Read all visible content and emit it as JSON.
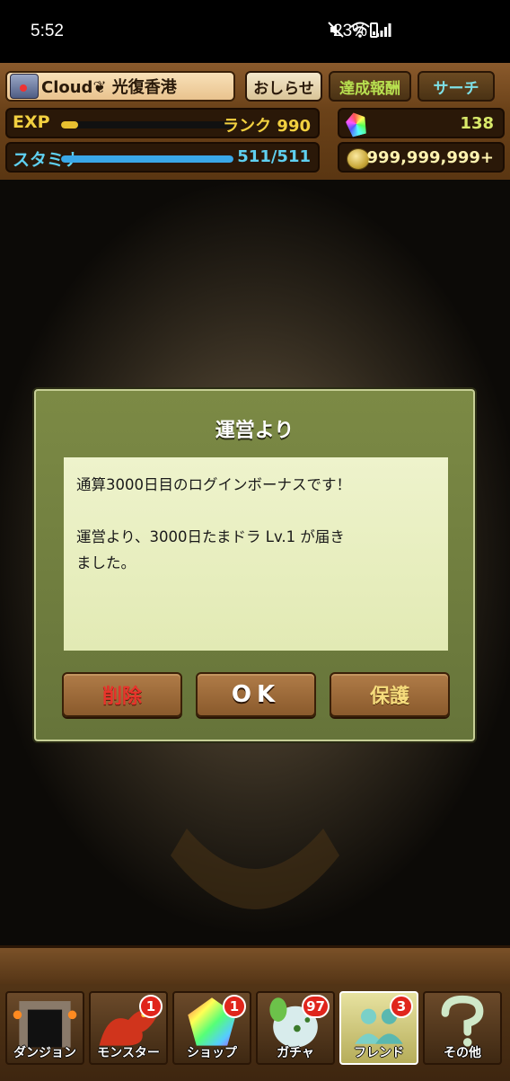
{
  "status_bar": {
    "time": "5:52",
    "battery": "23%"
  },
  "header": {
    "player_name": "Cloud❦ 光復香港",
    "news_label": "おしらせ",
    "achievements_label": "達成報酬",
    "search_label": "サーチ",
    "exp": {
      "label": "EXP",
      "rank_text": "ランク 990",
      "progress": 0.1
    },
    "stamina": {
      "label": "スタミナ",
      "value_text": "511/511",
      "progress": 1.0
    },
    "magic_stones": "138",
    "coins": "999,999,999+"
  },
  "dialog": {
    "title": "運営より",
    "message_lines": [
      "通算3000日目のログインボーナスです！",
      "",
      "運営より、3000日たまドラ  Lv.1 が届き",
      "ました。"
    ],
    "delete_label": "削除",
    "ok_label": "OK",
    "protect_label": "保護"
  },
  "nav": {
    "dungeon": {
      "label": "ダンジョン"
    },
    "monster": {
      "label": "モンスター",
      "badge": "1"
    },
    "shop": {
      "label": "ショップ",
      "badge": "1"
    },
    "gacha": {
      "label": "ガチャ",
      "badge": "97"
    },
    "friend": {
      "label": "フレンド",
      "badge": "3"
    },
    "other": {
      "label": "その他"
    }
  },
  "colors": {
    "exp_bar": "#e8c030",
    "stamina_bar": "#3aa8e8",
    "dialog_bg": "#6e7c3e",
    "badge": "#e0251c"
  }
}
